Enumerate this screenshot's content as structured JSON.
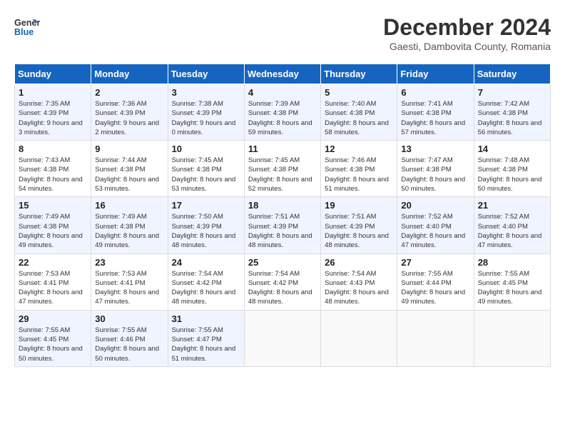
{
  "header": {
    "logo_line1": "General",
    "logo_line2": "Blue",
    "main_title": "December 2024",
    "subtitle": "Gaesti, Dambovita County, Romania"
  },
  "weekdays": [
    "Sunday",
    "Monday",
    "Tuesday",
    "Wednesday",
    "Thursday",
    "Friday",
    "Saturday"
  ],
  "weeks": [
    [
      {
        "day": "1",
        "sunrise": "Sunrise: 7:35 AM",
        "sunset": "Sunset: 4:39 PM",
        "daylight": "Daylight: 9 hours and 3 minutes."
      },
      {
        "day": "2",
        "sunrise": "Sunrise: 7:36 AM",
        "sunset": "Sunset: 4:39 PM",
        "daylight": "Daylight: 9 hours and 2 minutes."
      },
      {
        "day": "3",
        "sunrise": "Sunrise: 7:38 AM",
        "sunset": "Sunset: 4:39 PM",
        "daylight": "Daylight: 9 hours and 0 minutes."
      },
      {
        "day": "4",
        "sunrise": "Sunrise: 7:39 AM",
        "sunset": "Sunset: 4:38 PM",
        "daylight": "Daylight: 8 hours and 59 minutes."
      },
      {
        "day": "5",
        "sunrise": "Sunrise: 7:40 AM",
        "sunset": "Sunset: 4:38 PM",
        "daylight": "Daylight: 8 hours and 58 minutes."
      },
      {
        "day": "6",
        "sunrise": "Sunrise: 7:41 AM",
        "sunset": "Sunset: 4:38 PM",
        "daylight": "Daylight: 8 hours and 57 minutes."
      },
      {
        "day": "7",
        "sunrise": "Sunrise: 7:42 AM",
        "sunset": "Sunset: 4:38 PM",
        "daylight": "Daylight: 8 hours and 56 minutes."
      }
    ],
    [
      {
        "day": "8",
        "sunrise": "Sunrise: 7:43 AM",
        "sunset": "Sunset: 4:38 PM",
        "daylight": "Daylight: 8 hours and 54 minutes."
      },
      {
        "day": "9",
        "sunrise": "Sunrise: 7:44 AM",
        "sunset": "Sunset: 4:38 PM",
        "daylight": "Daylight: 8 hours and 53 minutes."
      },
      {
        "day": "10",
        "sunrise": "Sunrise: 7:45 AM",
        "sunset": "Sunset: 4:38 PM",
        "daylight": "Daylight: 8 hours and 53 minutes."
      },
      {
        "day": "11",
        "sunrise": "Sunrise: 7:45 AM",
        "sunset": "Sunset: 4:38 PM",
        "daylight": "Daylight: 8 hours and 52 minutes."
      },
      {
        "day": "12",
        "sunrise": "Sunrise: 7:46 AM",
        "sunset": "Sunset: 4:38 PM",
        "daylight": "Daylight: 8 hours and 51 minutes."
      },
      {
        "day": "13",
        "sunrise": "Sunrise: 7:47 AM",
        "sunset": "Sunset: 4:38 PM",
        "daylight": "Daylight: 8 hours and 50 minutes."
      },
      {
        "day": "14",
        "sunrise": "Sunrise: 7:48 AM",
        "sunset": "Sunset: 4:38 PM",
        "daylight": "Daylight: 8 hours and 50 minutes."
      }
    ],
    [
      {
        "day": "15",
        "sunrise": "Sunrise: 7:49 AM",
        "sunset": "Sunset: 4:38 PM",
        "daylight": "Daylight: 8 hours and 49 minutes."
      },
      {
        "day": "16",
        "sunrise": "Sunrise: 7:49 AM",
        "sunset": "Sunset: 4:38 PM",
        "daylight": "Daylight: 8 hours and 49 minutes."
      },
      {
        "day": "17",
        "sunrise": "Sunrise: 7:50 AM",
        "sunset": "Sunset: 4:39 PM",
        "daylight": "Daylight: 8 hours and 48 minutes."
      },
      {
        "day": "18",
        "sunrise": "Sunrise: 7:51 AM",
        "sunset": "Sunset: 4:39 PM",
        "daylight": "Daylight: 8 hours and 48 minutes."
      },
      {
        "day": "19",
        "sunrise": "Sunrise: 7:51 AM",
        "sunset": "Sunset: 4:39 PM",
        "daylight": "Daylight: 8 hours and 48 minutes."
      },
      {
        "day": "20",
        "sunrise": "Sunrise: 7:52 AM",
        "sunset": "Sunset: 4:40 PM",
        "daylight": "Daylight: 8 hours and 47 minutes."
      },
      {
        "day": "21",
        "sunrise": "Sunrise: 7:52 AM",
        "sunset": "Sunset: 4:40 PM",
        "daylight": "Daylight: 8 hours and 47 minutes."
      }
    ],
    [
      {
        "day": "22",
        "sunrise": "Sunrise: 7:53 AM",
        "sunset": "Sunset: 4:41 PM",
        "daylight": "Daylight: 8 hours and 47 minutes."
      },
      {
        "day": "23",
        "sunrise": "Sunrise: 7:53 AM",
        "sunset": "Sunset: 4:41 PM",
        "daylight": "Daylight: 8 hours and 47 minutes."
      },
      {
        "day": "24",
        "sunrise": "Sunrise: 7:54 AM",
        "sunset": "Sunset: 4:42 PM",
        "daylight": "Daylight: 8 hours and 48 minutes."
      },
      {
        "day": "25",
        "sunrise": "Sunrise: 7:54 AM",
        "sunset": "Sunset: 4:42 PM",
        "daylight": "Daylight: 8 hours and 48 minutes."
      },
      {
        "day": "26",
        "sunrise": "Sunrise: 7:54 AM",
        "sunset": "Sunset: 4:43 PM",
        "daylight": "Daylight: 8 hours and 48 minutes."
      },
      {
        "day": "27",
        "sunrise": "Sunrise: 7:55 AM",
        "sunset": "Sunset: 4:44 PM",
        "daylight": "Daylight: 8 hours and 49 minutes."
      },
      {
        "day": "28",
        "sunrise": "Sunrise: 7:55 AM",
        "sunset": "Sunset: 4:45 PM",
        "daylight": "Daylight: 8 hours and 49 minutes."
      }
    ],
    [
      {
        "day": "29",
        "sunrise": "Sunrise: 7:55 AM",
        "sunset": "Sunset: 4:45 PM",
        "daylight": "Daylight: 8 hours and 50 minutes."
      },
      {
        "day": "30",
        "sunrise": "Sunrise: 7:55 AM",
        "sunset": "Sunset: 4:46 PM",
        "daylight": "Daylight: 8 hours and 50 minutes."
      },
      {
        "day": "31",
        "sunrise": "Sunrise: 7:55 AM",
        "sunset": "Sunset: 4:47 PM",
        "daylight": "Daylight: 8 hours and 51 minutes."
      },
      null,
      null,
      null,
      null
    ]
  ]
}
